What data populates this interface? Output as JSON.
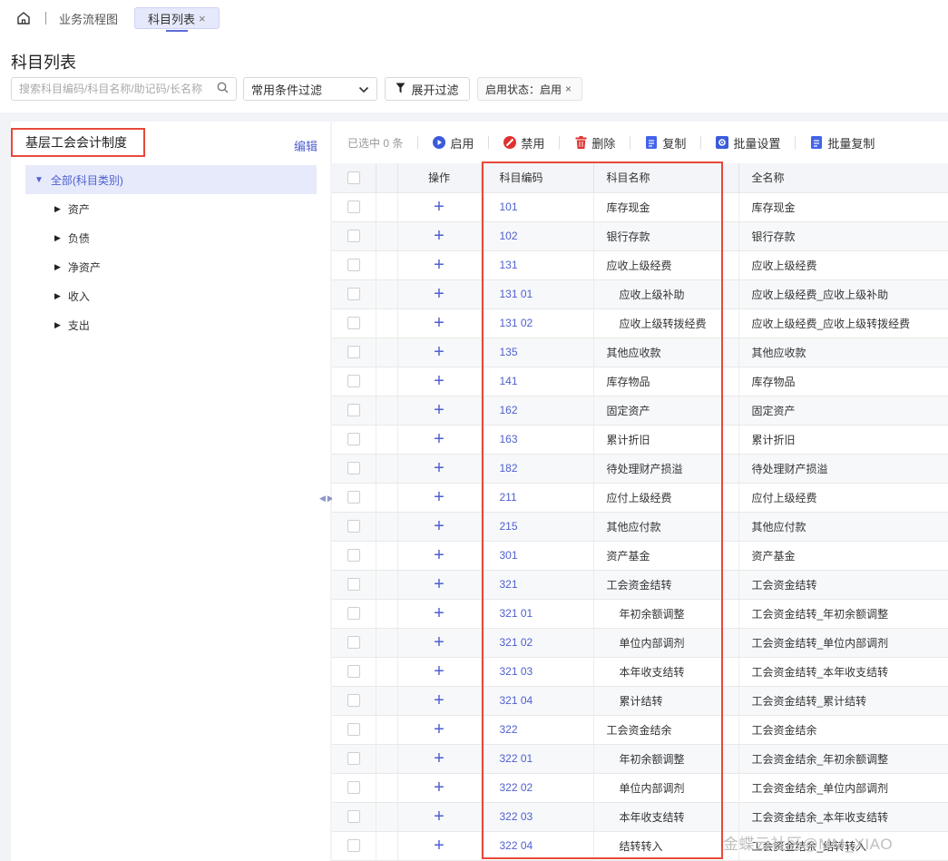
{
  "tabs": {
    "home_icon": "home-icon",
    "flow": "业务流程图",
    "active": "科目列表",
    "close": "×"
  },
  "header": {
    "title": "科目列表",
    "search_placeholder": "搜索科目编码/科目名称/助记码/长名称",
    "filter_select": "常用条件过滤",
    "expand_filter": "展开过滤",
    "status_tag": "启用状态：启用",
    "status_close": "×"
  },
  "tree": {
    "system": "基层工会会计制度",
    "edit": "编辑",
    "root": "全部(科目类别)",
    "items": [
      "资产",
      "负债",
      "净资产",
      "收入",
      "支出"
    ]
  },
  "toolbar": {
    "selected": "已选中 0 条",
    "enable": "启用",
    "disable": "禁用",
    "delete": "删除",
    "copy": "复制",
    "batch_set": "批量设置",
    "batch_copy": "批量复制",
    "colors": {
      "enable": "#3b5bdb",
      "disable": "#e03131",
      "delete": "#e03131",
      "copy": "#4263eb",
      "batch_set": "#3b5bdb",
      "batch_copy": "#4263eb"
    }
  },
  "table": {
    "columns": {
      "op": "操作",
      "code": "科目编码",
      "name": "科目名称",
      "full": "全名称"
    },
    "rows": [
      {
        "code": "101",
        "name": "库存现金",
        "full": "库存现金",
        "sub": false
      },
      {
        "code": "102",
        "name": "银行存款",
        "full": "银行存款",
        "sub": false
      },
      {
        "code": "131",
        "name": "应收上级经费",
        "full": "应收上级经费",
        "sub": false
      },
      {
        "code": "131 01",
        "name": "应收上级补助",
        "full": "应收上级经费_应收上级补助",
        "sub": true
      },
      {
        "code": "131 02",
        "name": "应收上级转拨经费",
        "full": "应收上级经费_应收上级转拨经费",
        "sub": true
      },
      {
        "code": "135",
        "name": "其他应收款",
        "full": "其他应收款",
        "sub": false
      },
      {
        "code": "141",
        "name": "库存物品",
        "full": "库存物品",
        "sub": false
      },
      {
        "code": "162",
        "name": "固定资产",
        "full": "固定资产",
        "sub": false
      },
      {
        "code": "163",
        "name": "累计折旧",
        "full": "累计折旧",
        "sub": false
      },
      {
        "code": "182",
        "name": "待处理财产损溢",
        "full": "待处理财产损溢",
        "sub": false
      },
      {
        "code": "211",
        "name": "应付上级经费",
        "full": "应付上级经费",
        "sub": false
      },
      {
        "code": "215",
        "name": "其他应付款",
        "full": "其他应付款",
        "sub": false
      },
      {
        "code": "301",
        "name": "资产基金",
        "full": "资产基金",
        "sub": false
      },
      {
        "code": "321",
        "name": "工会资金结转",
        "full": "工会资金结转",
        "sub": false
      },
      {
        "code": "321 01",
        "name": "年初余额调整",
        "full": "工会资金结转_年初余额调整",
        "sub": true
      },
      {
        "code": "321 02",
        "name": "单位内部调剂",
        "full": "工会资金结转_单位内部调剂",
        "sub": true
      },
      {
        "code": "321 03",
        "name": "本年收支结转",
        "full": "工会资金结转_本年收支结转",
        "sub": true
      },
      {
        "code": "321 04",
        "name": "累计结转",
        "full": "工会资金结转_累计结转",
        "sub": true
      },
      {
        "code": "322",
        "name": "工会资金结余",
        "full": "工会资金结余",
        "sub": false
      },
      {
        "code": "322 01",
        "name": "年初余额调整",
        "full": "工会资金结余_年初余额调整",
        "sub": true
      },
      {
        "code": "322 02",
        "name": "单位内部调剂",
        "full": "工会资金结余_单位内部调剂",
        "sub": true
      },
      {
        "code": "322 03",
        "name": "本年收支结转",
        "full": "工会资金结余_本年收支结转",
        "sub": true
      },
      {
        "code": "322 04",
        "name": "结转转入",
        "full": "工会资金结余_结转转入",
        "sub": true
      }
    ]
  },
  "watermark": "金蝶云社区@MM_XIAO"
}
